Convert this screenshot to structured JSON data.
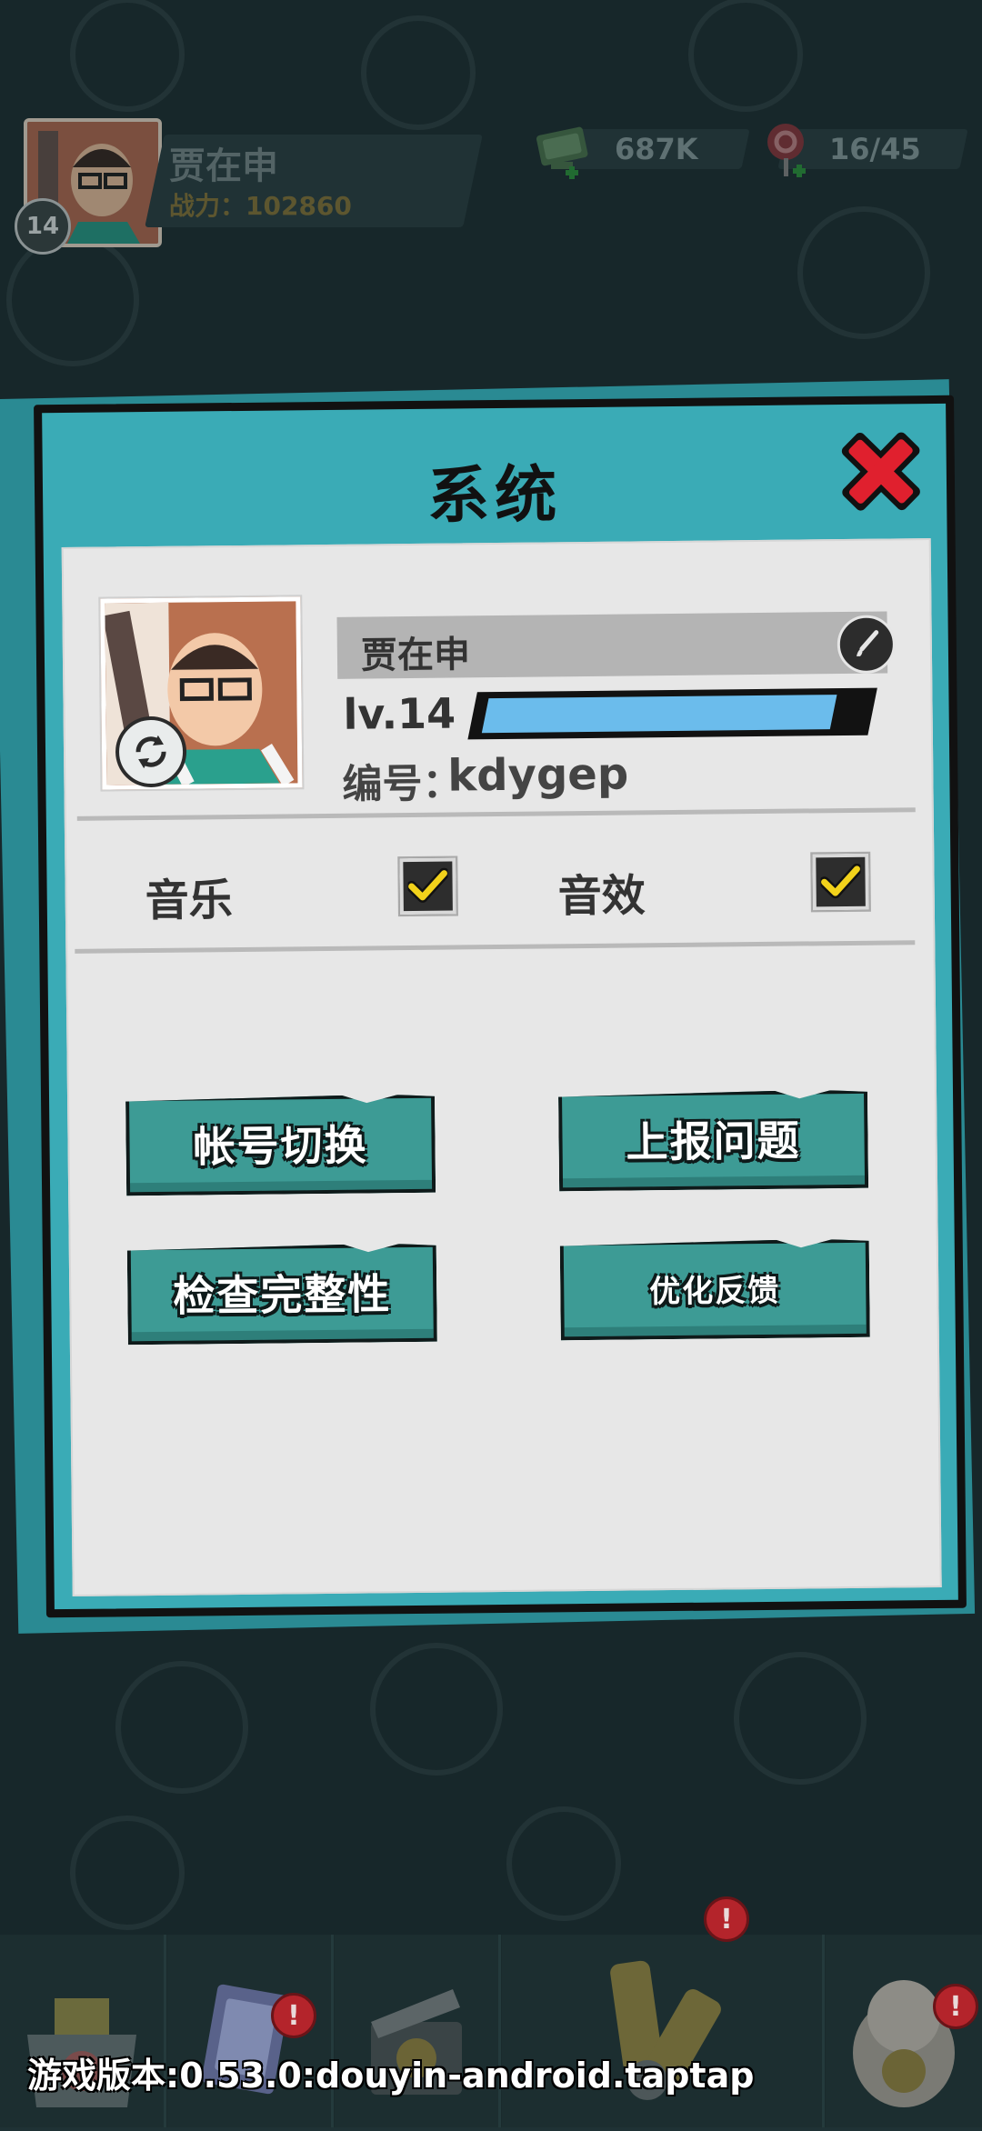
{
  "player": {
    "name": "贾在申",
    "level_badge": "14",
    "power_label": "战力：102860"
  },
  "resources": {
    "cash": "687K",
    "energy": "16/45"
  },
  "modal": {
    "title": "系统",
    "nickname": "贾在申",
    "level_text": "lv.14",
    "xp_progress": 0.93,
    "id_label": "编号：",
    "id_value": "kdygep",
    "music_label": "音乐",
    "music_checked": true,
    "sfx_label": "音效",
    "sfx_checked": true,
    "buttons": {
      "switch_account": "帐号切换",
      "report_issue": "上报问题",
      "check_integrity": "检查完整性",
      "feedback": "优化反馈"
    }
  },
  "bottom_nav": {
    "items": [
      "shop",
      "cards",
      "video",
      "tools",
      "lucky-cat"
    ],
    "badge_mark": "!"
  },
  "version_text": "游戏版本:0.53.0:douyin-android.taptap",
  "colors": {
    "background": "#1f3235",
    "modal_frame": "#3aabb6",
    "button_teal": "#3d9b95",
    "xp_fill": "#6bbcec",
    "close_red": "#e0202e",
    "check_yellow": "#f2d21b"
  }
}
